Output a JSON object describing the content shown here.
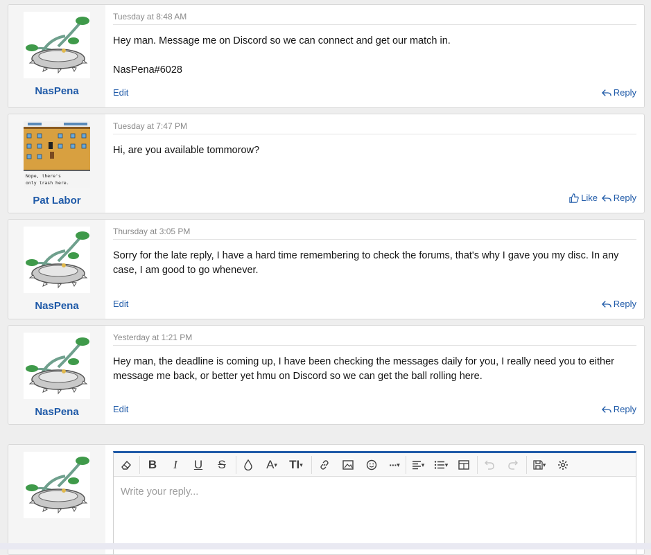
{
  "colors": {
    "link": "#1f5aa8",
    "editor_accent": "#1f5aa8"
  },
  "posts": [
    {
      "username": "NasPena",
      "avatar": "hanging-plant-sprite",
      "timestamp": "Tuesday at 8:48 AM",
      "paragraphs": [
        "Hey man. Message me on Discord so we can connect and get our match in.",
        "NasPena#6028"
      ],
      "edit_label": "Edit",
      "reply_label": "Reply"
    },
    {
      "username": "Pat Labor",
      "avatar": "pixel-game-screenshot",
      "avatar_text_1": "Nope, there's",
      "avatar_text_2": "only trash here.",
      "timestamp": "Tuesday at 7:47 PM",
      "paragraphs": [
        "Hi, are you available tommorow?"
      ],
      "like_label": "Like",
      "reply_label": "Reply"
    },
    {
      "username": "NasPena",
      "avatar": "hanging-plant-sprite",
      "timestamp": "Thursday at 3:05 PM",
      "paragraphs": [
        "Sorry for the late reply, I have a hard time remembering to check the forums, that's why I gave you my disc. In any case, I am good to go whenever."
      ],
      "edit_label": "Edit",
      "reply_label": "Reply"
    },
    {
      "username": "NasPena",
      "avatar": "hanging-plant-sprite",
      "timestamp": "Yesterday at 1:21 PM",
      "paragraphs": [
        "Hey man, the deadline is coming up, I have been checking the messages daily for you, I really need you to either message me back, or better yet hmu on Discord so we can get the ball rolling here."
      ],
      "edit_label": "Edit",
      "reply_label": "Reply"
    }
  ],
  "reply_editor": {
    "placeholder": "Write your reply...",
    "toolbar_icons": [
      "eraser-icon",
      "bold-icon",
      "italic-icon",
      "underline-icon",
      "strikethrough-icon",
      "text-color-icon",
      "font-family-icon",
      "font-size-icon",
      "link-icon",
      "image-icon",
      "smilie-icon",
      "more-icon",
      "align-icon",
      "list-icon",
      "table-icon",
      "undo-icon",
      "redo-icon",
      "drafts-icon",
      "settings-icon"
    ],
    "bold_glyph": "B",
    "italic_glyph": "I",
    "underline_glyph": "U",
    "strike_glyph": "S",
    "font_glyph": "A",
    "size_glyph": "TI"
  }
}
